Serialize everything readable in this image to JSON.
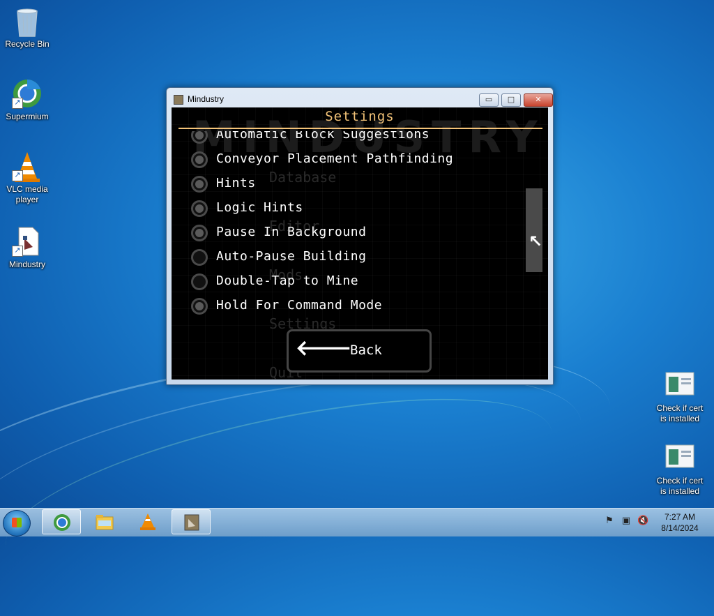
{
  "desktop": {
    "icons": [
      {
        "label": "Recycle Bin"
      },
      {
        "label": "Supermium"
      },
      {
        "label": "VLC media player"
      },
      {
        "label": "Mindustry"
      }
    ],
    "right_icons": [
      {
        "label": "Check if cert is installed"
      },
      {
        "label": "Check if cert is installed"
      }
    ]
  },
  "window": {
    "title": "Mindustry",
    "controls": {
      "minimize": "▭",
      "maximize": "□",
      "close": "✕"
    }
  },
  "game": {
    "background_logo": "MINDUSTRY",
    "background_menu": [
      "Database",
      "Editor",
      "Mods",
      "Settings",
      "Quit"
    ],
    "settings_title": "Settings",
    "options": [
      {
        "label": "Automatic Block Suggestions",
        "checked": true
      },
      {
        "label": "Conveyor Placement Pathfinding",
        "checked": true
      },
      {
        "label": "Hints",
        "checked": true
      },
      {
        "label": "Logic Hints",
        "checked": true
      },
      {
        "label": "Pause In Background",
        "checked": true
      },
      {
        "label": "Auto-Pause Building",
        "checked": false
      },
      {
        "label": "Double-Tap to Mine",
        "checked": false
      },
      {
        "label": "Hold For Command Mode",
        "checked": true
      }
    ],
    "back_label": "Back",
    "back_icon": "arrow-left-icon",
    "accent_color": "#f4c479"
  },
  "taskbar": {
    "pinned": [
      "Supermium",
      "Windows Explorer",
      "VLC media player",
      "Mindustry"
    ],
    "clock_time": "7:27 AM",
    "clock_date": "8/14/2024"
  }
}
